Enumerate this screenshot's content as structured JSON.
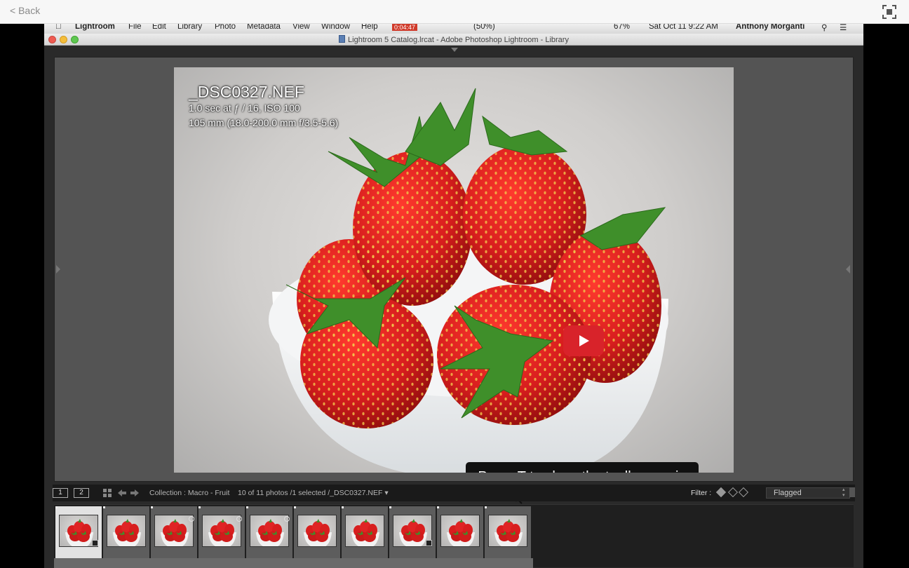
{
  "browser": {
    "back_label": "< Back"
  },
  "menubar": {
    "items": [
      {
        "label": "Lightroom",
        "bold": true
      },
      {
        "label": "File"
      },
      {
        "label": "Edit"
      },
      {
        "label": "Library"
      },
      {
        "label": "Photo"
      },
      {
        "label": "Metadata"
      },
      {
        "label": "View"
      },
      {
        "label": "Window"
      },
      {
        "label": "Help"
      }
    ],
    "recording_timer": "0:04:47",
    "battery": "(50%)",
    "battery_pct": "67%",
    "datetime": "Sat Oct 11  9:22 AM",
    "user": "Anthony Morganti"
  },
  "window": {
    "title": "Lightroom 5 Catalog.lrcat - Adobe Photoshop Lightroom - Library"
  },
  "photo_info": {
    "filename": "_DSC0327.NEF",
    "exposure": "1.0 sec at ƒ / 16, ISO 100",
    "lens": "105 mm (18.0-200.0 mm f/3.5-5.6)"
  },
  "toast": {
    "text": "Press T to show the toolbar again"
  },
  "filmstrip_toolbar": {
    "screen1": "1",
    "screen2": "2",
    "collection": "Collection : Macro - Fruit",
    "status": "10 of 11 photos /1 selected /_DSC0327.NEF ▾",
    "filter_label": "Filter :",
    "filter_value": "Flagged"
  },
  "filmstrip": {
    "thumbnails": [
      {
        "selected": true,
        "corner": true,
        "badge": false
      },
      {
        "selected": false,
        "corner": false,
        "badge": false
      },
      {
        "selected": false,
        "corner": false,
        "badge": true
      },
      {
        "selected": false,
        "corner": false,
        "badge": true
      },
      {
        "selected": false,
        "corner": false,
        "badge": true
      },
      {
        "selected": false,
        "corner": false,
        "badge": false
      },
      {
        "selected": false,
        "corner": false,
        "badge": false
      },
      {
        "selected": false,
        "corner": true,
        "badge": false
      },
      {
        "selected": false,
        "corner": false,
        "badge": false
      },
      {
        "selected": false,
        "corner": false,
        "badge": false
      }
    ]
  },
  "colors": {
    "play_button": "#d8232a",
    "strawberry": "#d81e1e",
    "leaf": "#3f8f2a"
  }
}
